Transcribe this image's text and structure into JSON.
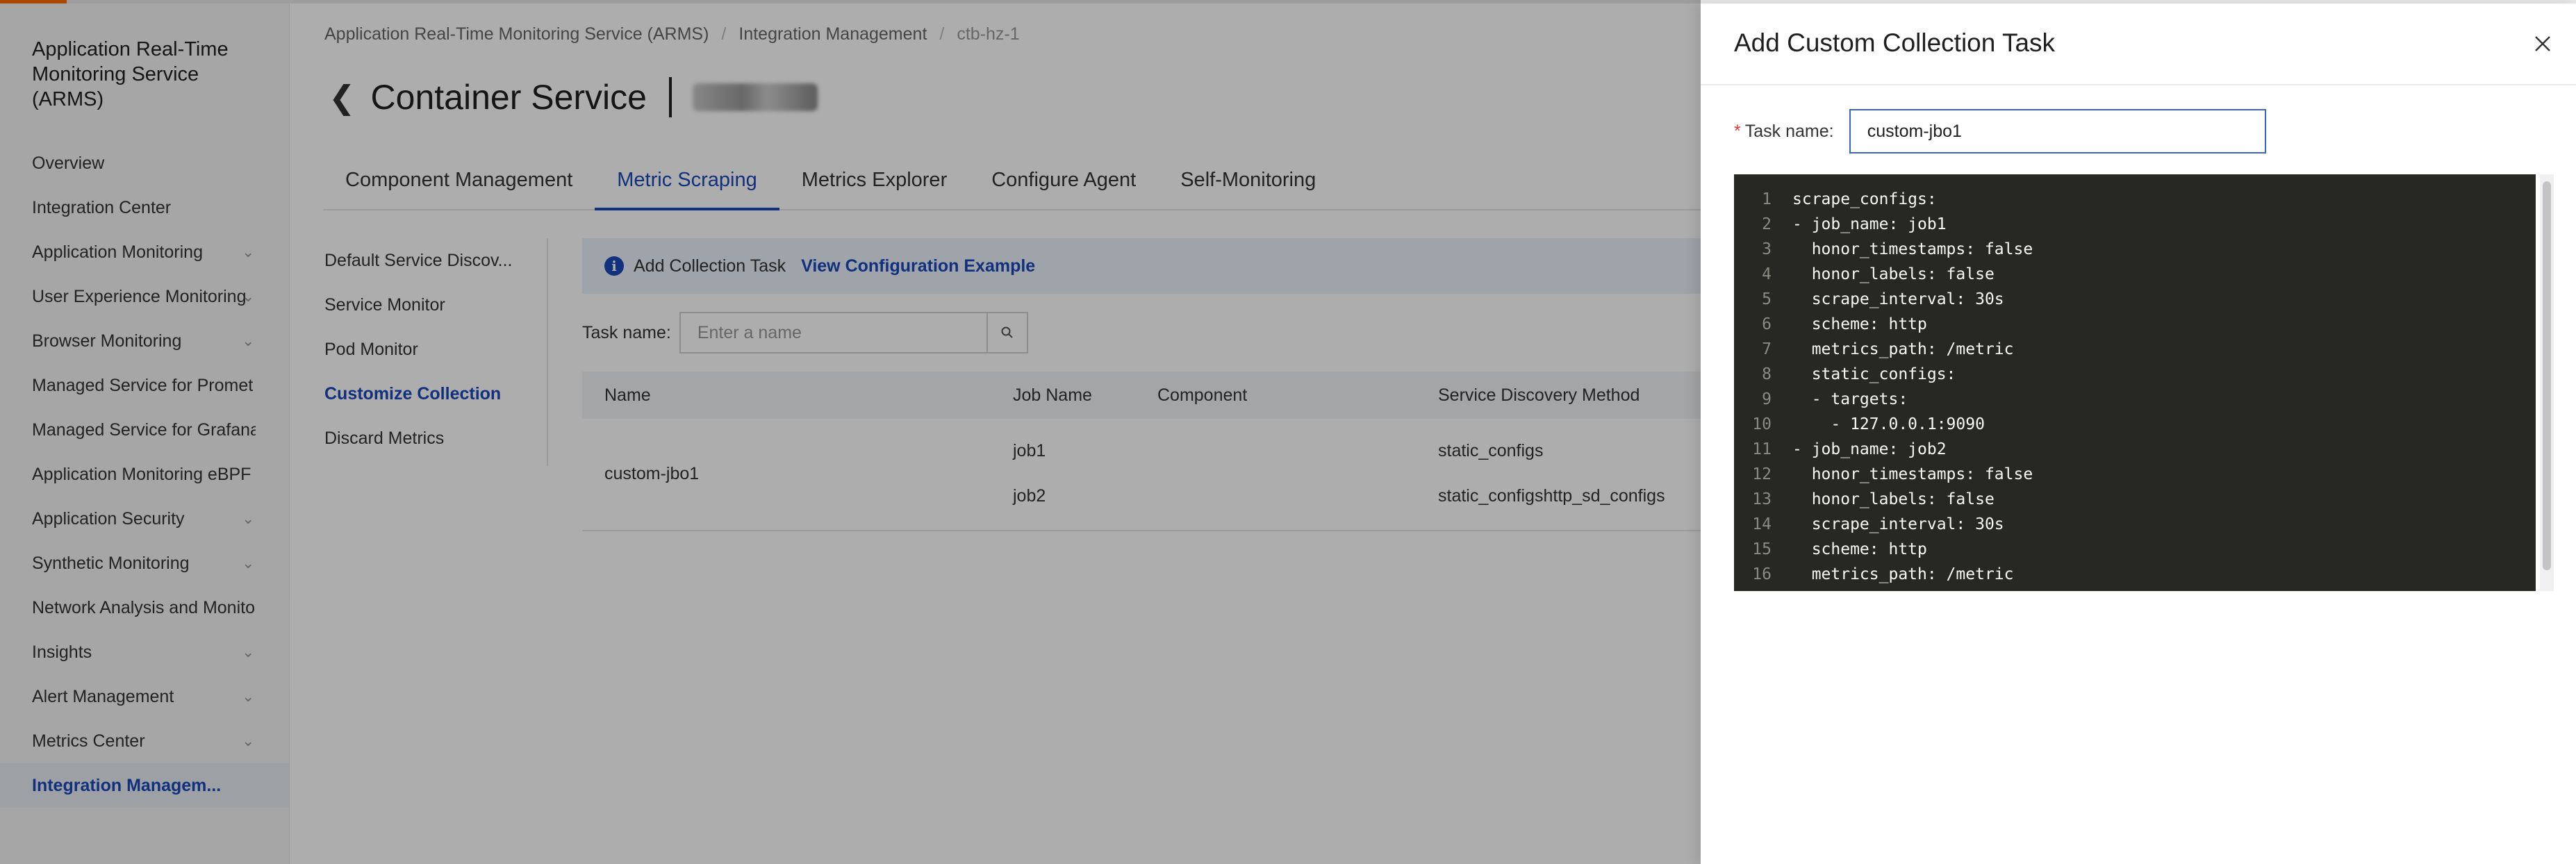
{
  "sidebar": {
    "title": "Application Real-Time Monitoring Service (ARMS)",
    "items": [
      {
        "label": "Overview",
        "chevron": false
      },
      {
        "label": "Integration Center",
        "chevron": false
      },
      {
        "label": "Application Monitoring",
        "chevron": true
      },
      {
        "label": "User Experience Monitoring",
        "chevron": true
      },
      {
        "label": "Browser Monitoring",
        "chevron": true
      },
      {
        "label": "Managed Service for Promet",
        "chevron": false
      },
      {
        "label": "Managed Service for Grafana",
        "chevron": false
      },
      {
        "label": "Application Monitoring eBPF",
        "chevron": false
      },
      {
        "label": "Application Security",
        "chevron": true
      },
      {
        "label": "Synthetic Monitoring",
        "chevron": true
      },
      {
        "label": "Network Analysis and Monito",
        "chevron": false
      },
      {
        "label": "Insights",
        "chevron": true
      },
      {
        "label": "Alert Management",
        "chevron": true
      },
      {
        "label": "Metrics Center",
        "chevron": true
      },
      {
        "label": "Integration Managem...",
        "chevron": false,
        "active": true
      }
    ]
  },
  "breadcrumb": {
    "items": [
      "Application Real-Time Monitoring Service (ARMS)",
      "Integration Management",
      "ctb-hz-1"
    ],
    "separator": "/"
  },
  "page": {
    "title": "Container Service"
  },
  "tabs": [
    "Component Management",
    "Metric Scraping",
    "Metrics Explorer",
    "Configure Agent",
    "Self-Monitoring"
  ],
  "active_tab": "Metric Scraping",
  "subnav": [
    "Default Service Discov...",
    "Service Monitor",
    "Pod Monitor",
    "Customize Collection",
    "Discard Metrics"
  ],
  "active_subnav": "Customize Collection",
  "info_bar": {
    "icon": "info-icon",
    "text": "Add Collection Task",
    "link": "View Configuration Example"
  },
  "filter": {
    "label": "Task name:",
    "placeholder": "Enter a name"
  },
  "table": {
    "columns": [
      "Name",
      "Job Name",
      "Component",
      "Service Discovery Method"
    ],
    "rows": [
      {
        "name": "custom-jbo1",
        "jobs": [
          "job1",
          "job2"
        ],
        "component": "",
        "methods": [
          "static_configs",
          "static_configshttp_sd_configs"
        ]
      }
    ]
  },
  "drawer": {
    "title": "Add Custom Collection Task",
    "task_label": "Task name:",
    "required_mark": "*",
    "task_value": "custom-jbo1",
    "code": [
      "scrape_configs:",
      "- job_name: job1",
      "  honor_timestamps: false",
      "  honor_labels: false",
      "  scrape_interval: 30s",
      "  scheme: http",
      "  metrics_path: /metric",
      "  static_configs:",
      "  - targets:",
      "    - 127.0.0.1:9090",
      "- job_name: job2",
      "  honor_timestamps: false",
      "  honor_labels: false",
      "  scrape_interval: 30s",
      "  scheme: http",
      "  metrics_path: /metric"
    ]
  },
  "colors": {
    "accent": "#1a47b8",
    "brand": "#ff6a00",
    "editor_bg": "#272822"
  }
}
